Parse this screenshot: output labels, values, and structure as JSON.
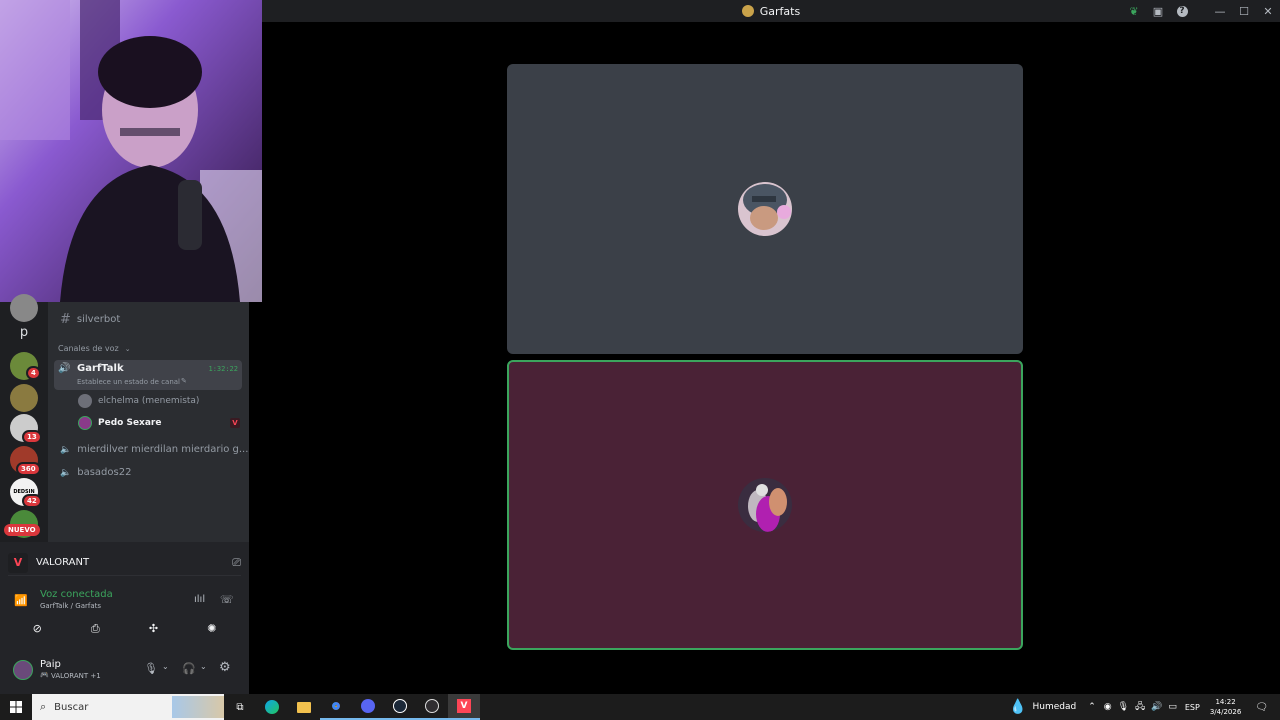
{
  "window": {
    "title": "Garfats"
  },
  "channels": {
    "text_channel": "silverbot",
    "voice_category": "Canales de voz",
    "active_voice": {
      "name": "GarfTalk",
      "timer": "1:32:22",
      "status_prompt": "Establece un estado de canal",
      "members": [
        {
          "name": "elchelma (menemista)",
          "bold": false
        },
        {
          "name": "Pedo Sexare",
          "bold": true
        }
      ]
    },
    "other_voice": [
      "mierdilver mierdilan mierdario g...",
      "basados22"
    ]
  },
  "servers": {
    "letter": "p",
    "badges": [
      "4",
      "13",
      "360",
      "42"
    ],
    "new_label": "NUEVO",
    "dedsin_label": "DEDSIN"
  },
  "activity": {
    "game": "VALORANT"
  },
  "voice_status": {
    "state": "Voz conectada",
    "location": "GarfTalk / Garfats"
  },
  "user": {
    "name": "Paip",
    "activity": "VALORANT +1"
  },
  "taskbar": {
    "search_placeholder": "Buscar",
    "weather": "Humedad",
    "lang": "ESP",
    "time": "14:22",
    "date": "3/4/2026"
  },
  "colors": {
    "accent_green": "#3ba55d",
    "badge_red": "#da373c",
    "tile_top": "#3b4048",
    "tile_bottom": "#4a2236"
  }
}
